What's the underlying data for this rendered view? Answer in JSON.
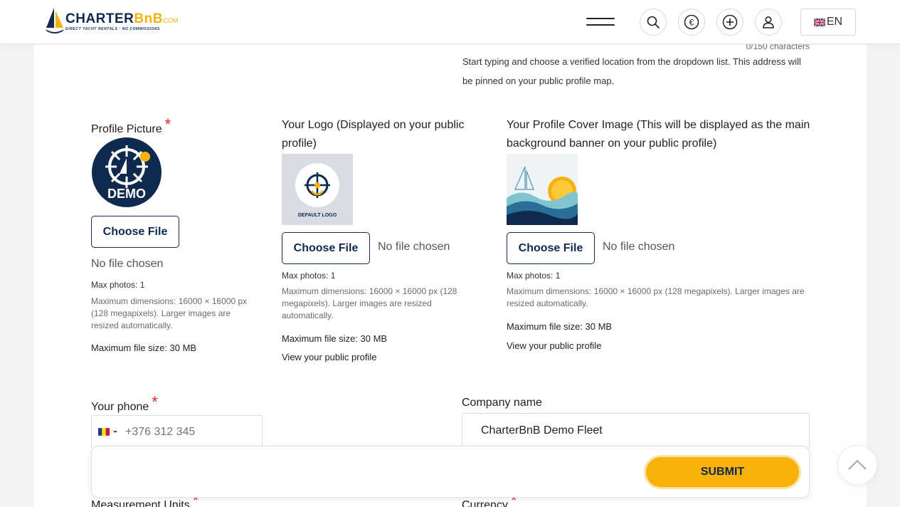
{
  "header": {
    "brand_main": "CHARTER",
    "brand_accent": "BnB",
    "brand_domain": ".COM",
    "brand_tagline": "DIRECT YACHT RENTALS · NO COMMISSIONS",
    "language_label": "EN",
    "icons": [
      "menu-icon",
      "search-icon",
      "euro-icon",
      "plus-circle-icon",
      "user-icon",
      "uk-flag-icon"
    ]
  },
  "location_field": {
    "char_counter": "0/150 characters",
    "hint": "Start typing and choose a verified location from the dropdown list. This address will be pinned on your public profile map."
  },
  "profile_picture": {
    "label": "Profile Picture",
    "required_mark": "*",
    "image_text": "DEMO",
    "button_label": "Choose File",
    "no_file_text": "No file chosen",
    "max_photos": "Max photos: 1",
    "dimensions_note": "Maximum dimensions: 16000 × 16000 px (128 megapixels). Larger images are resized automatically.",
    "max_size": "Maximum file size: 30 MB"
  },
  "logo": {
    "label": "Your Logo (Displayed on your public profile)",
    "image_text": "DEFAULT LOGO",
    "button_label": "Choose File",
    "no_file_text": "No file chosen",
    "max_photos": "Max photos: 1",
    "dimensions_note": "Maximum dimensions: 16000 × 16000 px (128 megapixels). Larger images are resized automatically.",
    "max_size": "Maximum file size: 30 MB",
    "profile_link": "View your public profile"
  },
  "cover": {
    "label": "Your Profile Cover Image (This will be displayed as the main background banner on your public profile)",
    "button_label": "Choose File",
    "no_file_text": "No file chosen",
    "max_photos": "Max photos: 1",
    "dimensions_note": "Maximum dimensions: 16000 × 16000 px (128 megapixels). Larger images are resized automatically.",
    "max_size": "Maximum file size: 30 MB",
    "profile_link": "View your public profile"
  },
  "phone": {
    "label": "Your phone",
    "required_mark": "*",
    "placeholder": "+376 312 345"
  },
  "company": {
    "label": "Company name",
    "value": "CharterBnB Demo Fleet"
  },
  "measurement_units": {
    "label": "Measurement Units",
    "required_mark": "*"
  },
  "currency": {
    "label": "Currency",
    "required_mark": "*"
  },
  "submit": {
    "label": "SUBMIT"
  },
  "colors": {
    "brand_navy": "#0e2a4e",
    "brand_yellow": "#f8b10b",
    "required_red": "#e02424"
  }
}
